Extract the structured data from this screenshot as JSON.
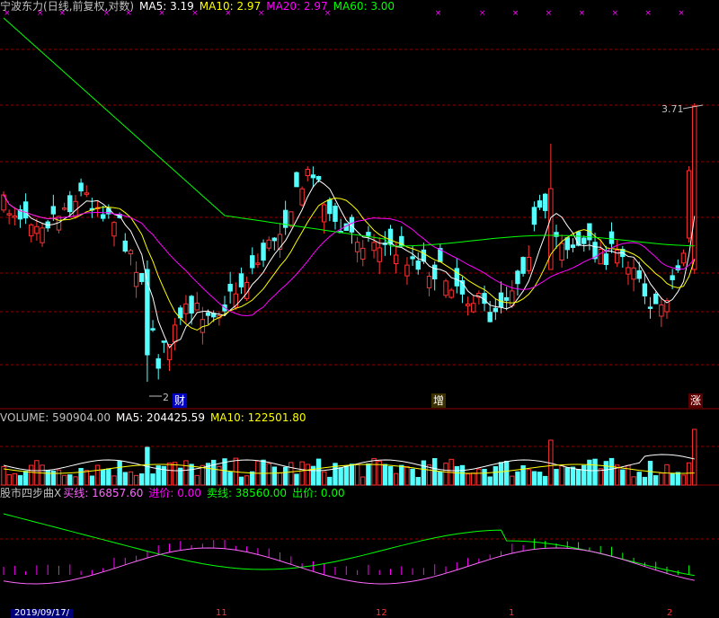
{
  "main": {
    "stock_name": "宁波东力",
    "mode": "(日线,前复权,对数)",
    "ma5": "MA5: 3.19",
    "ma10": "MA10: 2.97",
    "ma20": "MA20: 2.97",
    "ma60": "MA60: 3.00",
    "high_label": "3.71",
    "low_label": "2",
    "marker_cai": "财",
    "marker_zeng": "增",
    "marker_zhang": "涨"
  },
  "volume": {
    "title": "VOLUME: 590904.00",
    "ma5": "MA5: 204425.59",
    "ma10": "MA10: 122501.80"
  },
  "indicator": {
    "title": "股市四步曲X",
    "buy_line": "买线: 16857.60",
    "entry_price": "进价: 0.00",
    "sell_line": "卖线: 38560.00",
    "exit_price": "出价: 0.00"
  },
  "axis": {
    "date_label": "2019/09/17/",
    "tick_11": "11",
    "tick_12": "12",
    "tick_1": "1",
    "tick_2": "2"
  },
  "colors": {
    "up": "#ff3232",
    "down": "#54ffff",
    "ma5": "#ffffff",
    "ma10": "#ffff00",
    "ma20": "#ff00ff",
    "ma60": "#00ff00",
    "grid": "#8c0000"
  },
  "chart_data": [
    {
      "type": "candlestick",
      "title": "宁波东力",
      "scale": "log",
      "series": [
        {
          "name": "MA5",
          "values": []
        },
        {
          "name": "MA10",
          "values": []
        },
        {
          "name": "MA20",
          "values": []
        },
        {
          "name": "MA60",
          "values": []
        }
      ],
      "annotations": [
        "3.71",
        "2"
      ]
    },
    {
      "type": "bar",
      "title": "VOLUME",
      "series": [
        {
          "name": "VOLUME",
          "values": []
        },
        {
          "name": "MA5",
          "values": []
        },
        {
          "name": "MA10",
          "values": []
        }
      ]
    },
    {
      "type": "line",
      "title": "股市四步曲X",
      "series": [
        {
          "name": "买线",
          "values": []
        },
        {
          "name": "卖线",
          "values": []
        }
      ]
    }
  ]
}
